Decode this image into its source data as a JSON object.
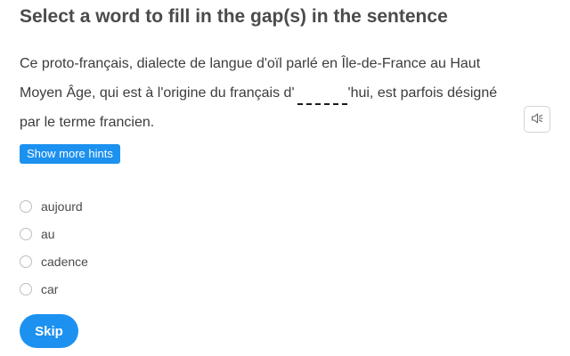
{
  "title": "Select a word to fill in the gap(s) in the sentence",
  "sentence": {
    "before": "Ce proto-français, dialecte de langue d'oïl parlé en Île-de-France au Haut Moyen Âge, qui est à l'origine du français d'",
    "after": "'hui, est parfois désigné par le terme francien."
  },
  "speaker": {
    "icon": "speaker-icon"
  },
  "hints_button": {
    "label": "Show more hints"
  },
  "options": [
    {
      "label": "aujourd"
    },
    {
      "label": "au"
    },
    {
      "label": "cadence"
    },
    {
      "label": "car"
    }
  ],
  "skip_button": {
    "label": "Skip"
  },
  "colors": {
    "accent": "#1c91f0",
    "text": "#3c3c3c",
    "title": "#4b4b4b"
  }
}
